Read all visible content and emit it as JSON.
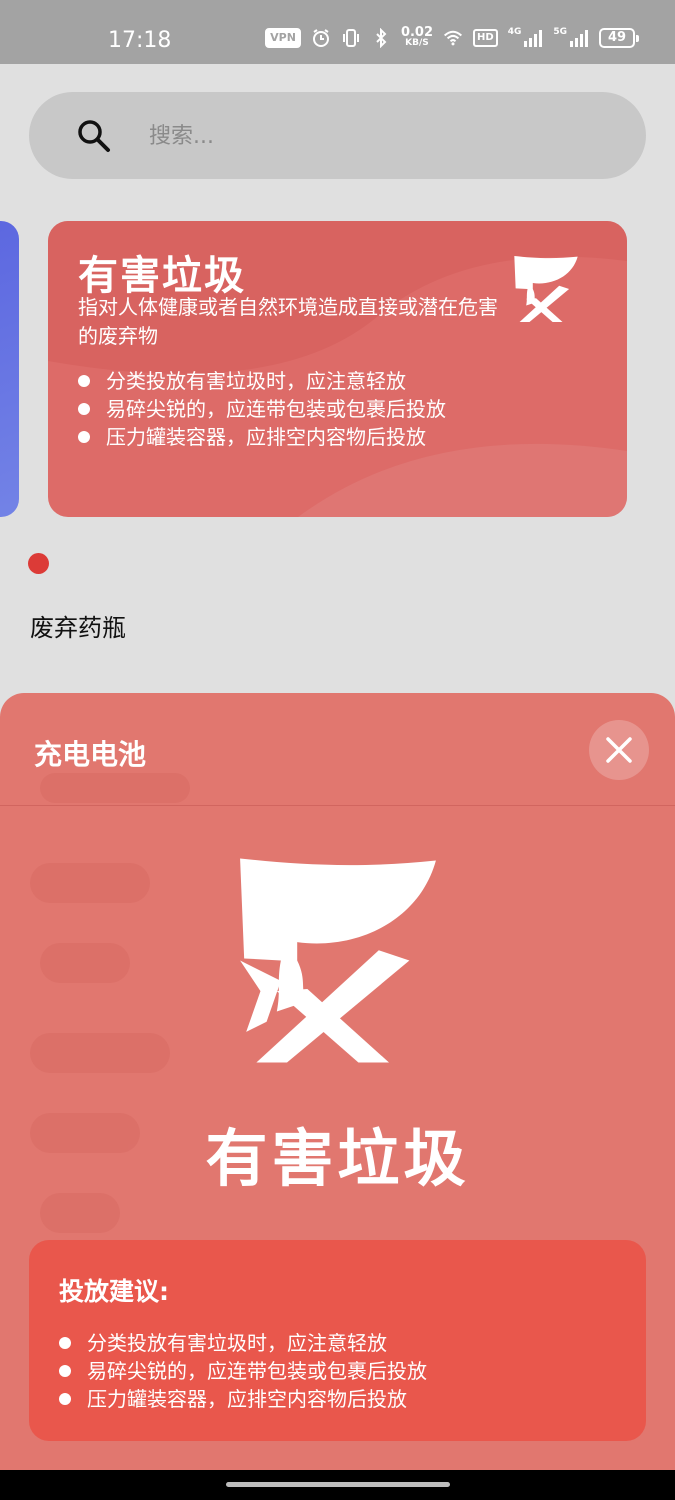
{
  "status_bar": {
    "time": "17:18",
    "vpn_label": "VPN",
    "speed_value": "0.02",
    "speed_unit": "KB/S",
    "hd_label": "HD",
    "net1_label": "4G",
    "net2_label": "5G",
    "battery": "49",
    "icons": [
      "alarm-icon",
      "vibrate-icon",
      "bluetooth-icon",
      "wifi-icon",
      "signal-icon"
    ]
  },
  "search": {
    "placeholder": "搜索..."
  },
  "category_card": {
    "title": "有害垃圾",
    "description": "指对人体健康或者自然环境造成直接或潜在危害的废弃物",
    "tips": [
      "分类投放有害垃圾时，应注意轻放",
      "易碎尖锐的，应连带包装或包裹后投放",
      "压力罐装容器，应排空内容物后投放"
    ],
    "color": "#dd6b68"
  },
  "side_card_color": "#5c67e0",
  "list": {
    "item": "废弃药瓶"
  },
  "sheet": {
    "title": "充电电池",
    "category": "有害垃圾",
    "advice_title": "投放建议:",
    "advice": [
      "分类投放有害垃圾时，应注意轻放",
      "易碎尖锐的，应连带包装或包裹后投放",
      "压力罐装容器，应排空内容物后投放"
    ],
    "color": "#e1776f",
    "advice_color": "#e9574c"
  }
}
